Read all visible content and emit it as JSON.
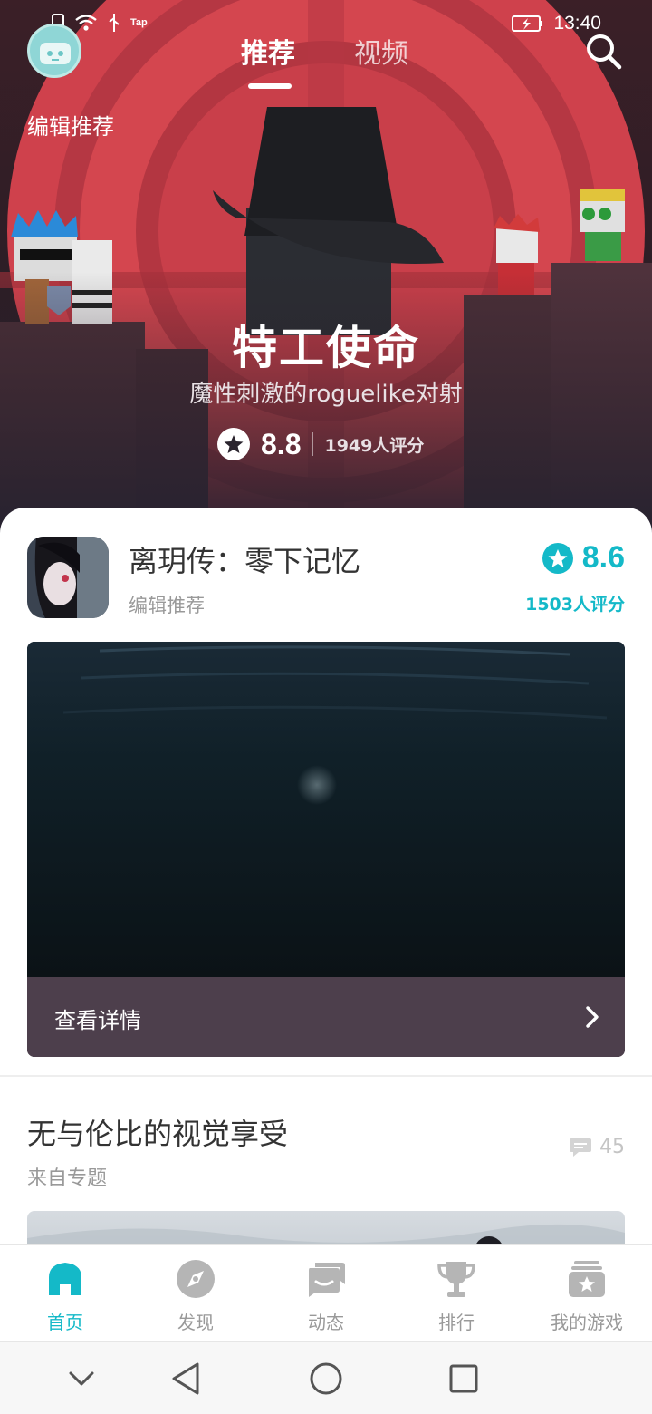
{
  "status_bar": {
    "time": "13:40",
    "tap_label": "Tap"
  },
  "header": {
    "tabs": [
      {
        "label": "推荐",
        "active": true
      },
      {
        "label": "视频",
        "active": false
      }
    ],
    "search_icon": "search-icon",
    "avatar_icon": "robot-avatar-icon"
  },
  "hero": {
    "tag": "编辑推荐",
    "title": "特工使命",
    "subtitle": "魔性刺激的roguelike对射",
    "score": "8.8",
    "rating_count": "1949人评分"
  },
  "featured_game": {
    "name": "离玥传：零下记忆",
    "tag": "编辑推荐",
    "score": "8.6",
    "rating_count": "1503人评分",
    "video_action": "查看详情"
  },
  "topic": {
    "title": "无与伦比的视觉享受",
    "source": "来自专题",
    "comment_count": "45"
  },
  "bottom_nav": {
    "items": [
      {
        "label": "首页",
        "icon": "home-icon",
        "active": true
      },
      {
        "label": "发现",
        "icon": "compass-icon",
        "active": false
      },
      {
        "label": "动态",
        "icon": "chat-bubbles-icon",
        "active": false
      },
      {
        "label": "排行",
        "icon": "trophy-icon",
        "active": false
      },
      {
        "label": "我的游戏",
        "icon": "game-box-icon",
        "active": false
      }
    ]
  },
  "colors": {
    "accent": "#14b9c8",
    "hero_red": "#d0434e",
    "video_bar": "#4d3f4c"
  }
}
